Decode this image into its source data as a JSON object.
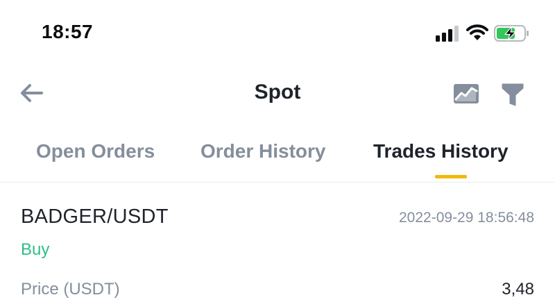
{
  "status_bar": {
    "time": "18:57",
    "icons": [
      "cellular-signal-icon",
      "wifi-icon",
      "battery-charging-icon"
    ]
  },
  "header": {
    "title": "Spot",
    "back_icon": "arrow-left-icon",
    "chart_icon": "chart-icon",
    "filter_icon": "filter-icon"
  },
  "tabs": [
    {
      "label": "Open Orders",
      "active": false
    },
    {
      "label": "Order History",
      "active": false
    },
    {
      "label": "Trades History",
      "active": true
    }
  ],
  "trade": {
    "pair": "BADGER/USDT",
    "time": "2022-09-29 18:56:48",
    "side": "Buy",
    "price_label": "Price (USDT)",
    "price_value": "3,48"
  },
  "colors": {
    "accent": "#f0b90b",
    "buy": "#2ebd85",
    "muted": "#848e9c",
    "text": "#1e2329",
    "battery_charge": "#34c759"
  }
}
